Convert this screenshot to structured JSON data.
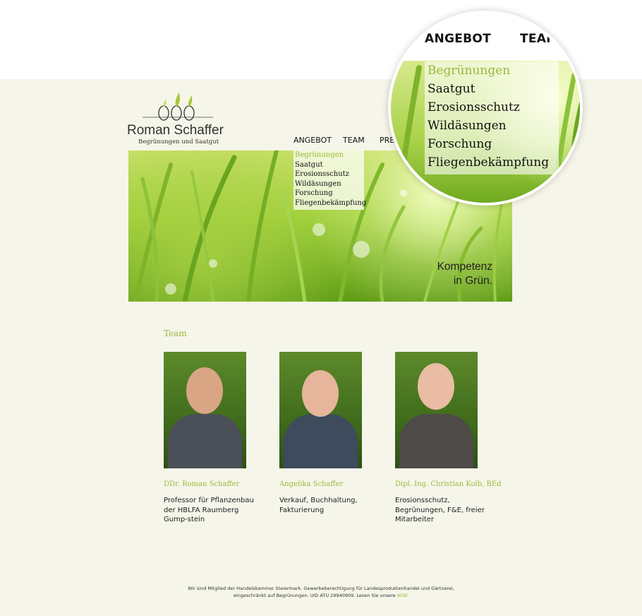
{
  "brand": {
    "name": "Roman Schaffer",
    "tagline": "Begrünungen und Saatgut"
  },
  "nav": {
    "items": [
      "ANGEBOT",
      "TEAM",
      "PRE"
    ]
  },
  "dropdown": {
    "items": [
      "Begrünungen",
      "Saatgut",
      "Erosionsschutz",
      "Wildäsungen",
      "Forschung",
      "Fliegenbekämpfung"
    ],
    "active": "Begrünungen"
  },
  "zoom": {
    "nav": [
      "ANGEBOT",
      "TEAM"
    ],
    "items": [
      "Begrünungen",
      "Saatgut",
      "Erosionsschutz",
      "Wildäsungen",
      "Forschung",
      "Fliegenbekämpfung"
    ]
  },
  "hero": {
    "slogan_line1": "Kompetenz",
    "slogan_line2": "in Grün."
  },
  "team": {
    "title": "Team",
    "members": [
      {
        "name": "DDr. Roman Schaffer",
        "role": "Professor für Pflanzenbau der HBLFA Raumberg Gump-stein"
      },
      {
        "name": "Angelika Schaffer",
        "role": "Verkauf, Buchhaltung, Fakturierung"
      },
      {
        "name": "Dipl. Ing. Christian Kolb, BEd",
        "role": "Erosionsschutz, Begrünungen, F&E, freier Mitarbeiter"
      }
    ]
  },
  "footer": {
    "line1": "Wir sind Mitglied der Handelskammer Steiermark. Gewerbeberechtigung für Landesproduktenhandel und Gärtnerei,",
    "line2": "eingeschränkt auf Begrünungen. UID ATU 29940909. Lesen Sie unsere",
    "link": "AGB!"
  },
  "colors": {
    "accent": "#9cb83a",
    "page_bg": "#f6f5ea",
    "text": "#222222"
  }
}
